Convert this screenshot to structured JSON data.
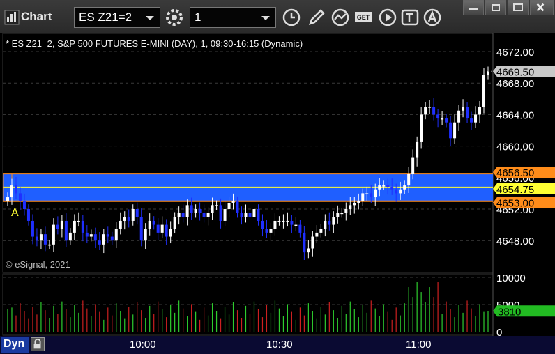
{
  "window": {
    "title": "Chart",
    "symbol": "ES Z21=2",
    "interval": "1"
  },
  "toolbar_icons": [
    "settings-icon",
    "clock-icon",
    "pen-icon",
    "study-icon",
    "get-icon",
    "play-icon",
    "text-icon",
    "alert-icon"
  ],
  "window_buttons": [
    "restore-icon",
    "maximize-icon",
    "close-icon"
  ],
  "chart": {
    "info": "* ES Z21=2, S&P 500 FUTURES E-MINI (DAY), 1, 09:30-16:15 (Dynamic)",
    "copyright": "© eSignal, 2021",
    "annotation_label": "A",
    "price_labels": [
      "4672.00",
      "4668.00",
      "4664.00",
      "4660.00",
      "4652.00",
      "4648.00"
    ],
    "marker_last": "4669.50",
    "marker_high": "4656.50",
    "marker_mid": "4654.75",
    "marker_low": "4653.00",
    "hidden_label": "4656.00",
    "volume_labels": [
      "10000",
      "5000",
      "0"
    ],
    "volume_marker": "3810",
    "time_labels": [
      "10:00",
      "10:30",
      "11:00"
    ],
    "dyn_label": "Dyn",
    "colors": {
      "up": "#ffffff",
      "down": "#1f2fff",
      "band": "#1f5fff",
      "orange": "#ff8c1a",
      "yellow": "#ffff33",
      "vol_up": "#2ecc2e",
      "vol_down": "#cc2020"
    }
  },
  "chart_data": {
    "type": "candlestick",
    "interval_minutes": 1,
    "x_ticks": [
      "10:00",
      "10:30",
      "11:00"
    ],
    "ylim": [
      4646.0,
      4673.0
    ],
    "closes": [
      4653.5,
      4655.0,
      4654.0,
      4653.0,
      4652.0,
      4650.5,
      4648.5,
      4648.0,
      4648.8,
      4647.5,
      4647.5,
      4650.0,
      4649.5,
      4650.5,
      4648.0,
      4649.0,
      4650.5,
      4650.5,
      4649.0,
      4648.5,
      4648.8,
      4648.0,
      4647.5,
      4648.8,
      4648.5,
      4648.0,
      4649.5,
      4650.5,
      4651.0,
      4650.5,
      4652.0,
      4651.0,
      4648.0,
      4649.5,
      4650.5,
      4650.0,
      4649.0,
      4650.0,
      4648.5,
      4649.5,
      4651.0,
      4651.5,
      4651.0,
      4652.5,
      4651.5,
      4652.0,
      4651.5,
      4651.0,
      4651.5,
      4652.5,
      4652.5,
      4650.5,
      4652.0,
      4652.8,
      4653.0,
      4651.5,
      4651.0,
      4651.5,
      4651.0,
      4652.0,
      4650.5,
      4649.5,
      4649.0,
      4649.5,
      4650.5,
      4650.5,
      4650.5,
      4650.5,
      4650.0,
      4650.0,
      4649.0,
      4646.5,
      4647.0,
      4648.5,
      4649.0,
      4649.5,
      4650.5,
      4650.0,
      4651.0,
      4651.5,
      4651.5,
      4652.0,
      4652.5,
      4652.8,
      4653.0,
      4654.0,
      4654.0,
      4653.5,
      4654.5,
      4655.0,
      4655.0,
      4654.8,
      4654.5,
      4654.0,
      4654.5,
      4655.0,
      4656.5,
      4658.5,
      4660.5,
      4664.0,
      4665.0,
      4665.0,
      4664.0,
      4663.5,
      4663.5,
      4663.0,
      4661.0,
      4663.0,
      4664.5,
      4665.0,
      4663.5,
      4663.0,
      4664.0,
      4665.0,
      4669.0,
      4669.5
    ],
    "volume_ylim": [
      0,
      10000
    ],
    "volume_last": 3810,
    "levels": {
      "last": 4669.5,
      "band_top": 4656.5,
      "midline": 4654.75,
      "band_bottom": 4653.0
    }
  }
}
